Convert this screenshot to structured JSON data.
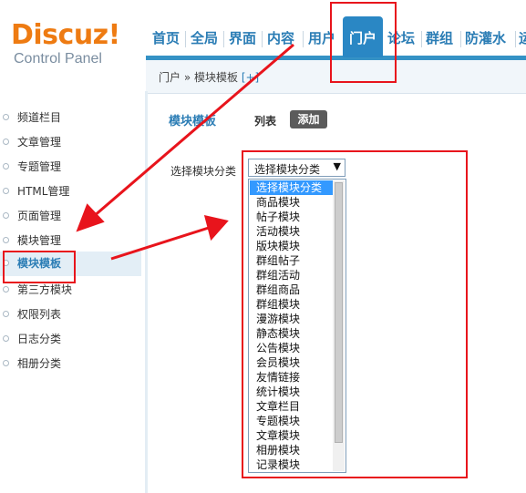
{
  "logo": {
    "main": "Discuz!",
    "sub": "Control Panel"
  },
  "nav": {
    "items": [
      "首页",
      "全局",
      "界面",
      "内容",
      "用户",
      "门户",
      "论坛",
      "群组",
      "防灌水",
      "运"
    ],
    "active": "门户"
  },
  "breadcrumb": {
    "parts": "门户 » 模块模板",
    "add": "[+]"
  },
  "sidebar": {
    "items": [
      {
        "label": "频道栏目"
      },
      {
        "label": "文章管理"
      },
      {
        "label": "专题管理"
      },
      {
        "label": "HTML管理"
      },
      {
        "label": "页面管理"
      },
      {
        "label": "模块管理"
      },
      {
        "label": "模块模板"
      },
      {
        "label": "第三方模块"
      },
      {
        "label": "权限列表"
      },
      {
        "label": "日志分类"
      },
      {
        "label": "相册分类"
      }
    ],
    "active_index": 6
  },
  "main": {
    "title": "模块模板",
    "tab_list": "列表",
    "tab_add": "添加",
    "select_label": "选择模块分类",
    "select_value": "选择模块分类"
  },
  "dropdown": {
    "options": [
      "选择模块分类",
      "商品模块",
      "帖子模块",
      "活动模块",
      "版块模块",
      "群组帖子",
      "群组活动",
      "群组商品",
      "群组模块",
      "漫游模块",
      "静态模块",
      "公告模块",
      "会员模块",
      "友情链接",
      "统计模块",
      "文章栏目",
      "专题模块",
      "文章模块",
      "相册模块",
      "记录模块"
    ],
    "selected_index": 0
  },
  "colors": {
    "brand_orange": "#ee7b12",
    "nav_blue": "#2b7db5",
    "active_tab": "#2a87c4",
    "annotation_red": "#e8141c",
    "selection_blue": "#3399ff"
  }
}
